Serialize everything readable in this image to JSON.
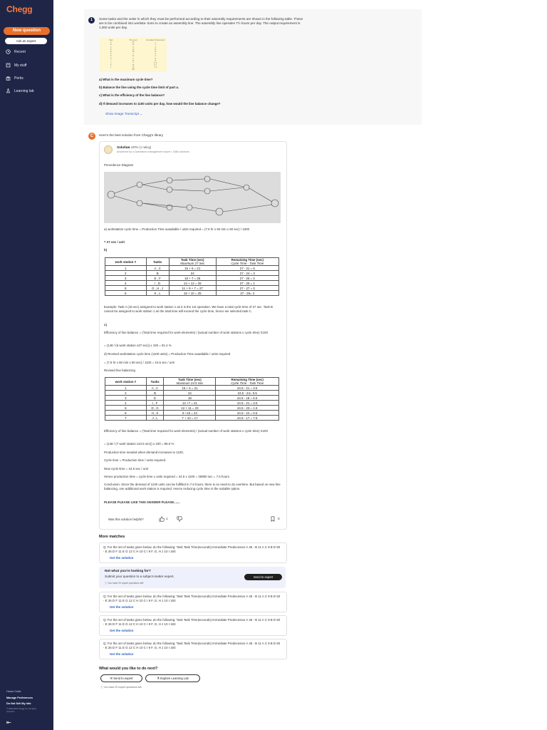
{
  "sidebar": {
    "logo": "Chegg",
    "new_question": "New question",
    "ask_expert": "Ask an expert",
    "nav": [
      {
        "label": "Recent",
        "icon": "clock-icon"
      },
      {
        "label": "My stuff",
        "icon": "box-icon"
      },
      {
        "label": "Perks",
        "icon": "gift-icon"
      },
      {
        "label": "Learning lab",
        "icon": "flask-icon"
      }
    ],
    "footer": [
      "Honor Code",
      "Manage Preferences",
      "Do Not Sell My Info"
    ],
    "copyright": "© 2003-2024 Chegg Inc. All rights reserved."
  },
  "question": {
    "number": "1",
    "text": "Some tasks and the order in which they must be performed according to their assembly requirements are shown in the following table. These are to be combined into worksta- tions to create an assembly line. The assembly line operates 7½ hours per day. The output requirement is 1,000 units per day.",
    "parts": [
      "a) What is the maximum cycle time?",
      "b) Balance the line using the cycle time limit of part a.",
      "c) What is the efficiency of the line balance?",
      "d) If demand increases to 1100 units per day, how would the line balance change?"
    ],
    "show_transcript": "Show Image Transcript"
  },
  "answer": {
    "intro": "Here's the best solution from Chegg's library",
    "solution_label": "Solution",
    "rating": "100% (1 rating)",
    "answered_by": "Answered by a Operations management expert  •  1684 solutions",
    "precedence": "Precedence Diagram",
    "a_line": "a) workstation cycle time = Production Time avaailable / units required = (7.5 hr x 60 min x 60 sec) / 1000",
    "a_result": "= 27 sec / unit",
    "b_label": "b)",
    "table1": {
      "headers": [
        "work station #",
        "Tasks",
        "Task Time (sec)",
        "Remaining Time (sec)"
      ],
      "subheaders": [
        "Maximum 27 Sec",
        "Cycle Time - Task Time"
      ],
      "rows": [
        [
          "1",
          "A , C",
          "15 + 6 = 21",
          "27 - 21 = 6"
        ],
        [
          "2",
          "B",
          "24",
          "27 - 24 = 3"
        ],
        [
          "3",
          "E , F",
          "18 + 7 = 25",
          "27 - 25 = 2"
        ],
        [
          "4",
          "I , D",
          "14 + 12 = 26",
          "27 - 26 = 1"
        ],
        [
          "5",
          "G , H , J",
          "11 + 9 + 7 = 27",
          "27 - 27 = 0"
        ],
        [
          "6",
          "K , L",
          "15 + 10 = 25",
          "27 - 25= 2"
        ]
      ]
    },
    "example": "Example: Task A (15 sec) assigned to work station 1 as it is the 1st operation. We have a total cycle time of 27 sec. Task B cannot be assigned to work station 1 as the total time will exceed the cycle time, hence we selected task C.",
    "c_label": "c)",
    "eff1": "Efficiency of line balance = (Total time required for work elements) / (actual number of work stations x cycle time) X100",
    "eff1_result": "= (148 / (6 work station x27 sec)) x 100 = 91.4 %",
    "d_line": "d) Revised workstation cycle time (1100 units) = Production Time avaailable / units required",
    "d_result": "= (7.5 hr x 60 min x 60 sec) / 1100 = 24.5 sec / unit",
    "revised": "Revised line balancing",
    "table2": {
      "headers": [
        "work station #",
        "Tasks",
        "Task Time (sec)",
        "Remaining Time (sec)"
      ],
      "subheaders": [
        "Maximum 24.5 Sec",
        "Cycle Time - Task Time"
      ],
      "rows": [
        [
          "1",
          "A , C",
          "15 + 6 = 21",
          "24.5 - 21 = 3.5"
        ],
        [
          "2",
          "B",
          "24",
          "24.5 - 24= 0.5"
        ],
        [
          "3",
          "E",
          "18",
          "24.5 - 18 = 6.5"
        ],
        [
          "4",
          "I , F",
          "14 +7 = 21",
          "24.5 - 21 = 3.5"
        ],
        [
          "5",
          "D , G",
          "12 + 11 = 23",
          "24.5 - 23 = 1.5"
        ],
        [
          "6",
          "H , K",
          "9 +15 = 24",
          "24.5 - 24 = 0.5"
        ],
        [
          "7",
          "J , L",
          "7 + 10 = 17",
          "24.5 - 17 = 7.5"
        ]
      ]
    },
    "eff2": "Efficiency of line balance = (Total time required for work elements) / (actual number of work stations x cycle time) X100",
    "eff2_result": "= (148 / (7 work station x24.5 sec)) x 100 = 86.0 %",
    "prod_time": "Production time needed when demand increases to 1100,",
    "cycle_eq": "Cycle time = Production time / units required",
    "new_cycle": "New cycle time = 24.5 sec / unit",
    "hence": "Hence production time = cycle time x units required = 24.5 x 1100 = 26950 sec = 7.5 hours",
    "conclusion": "Conclusion: Since the demand of 1100 units can be fulfilled in 7.5 hours, there is no need to do overtime. But based on new line balancing, one additional work station is required. Hence reducing cycle time is the suitable option.",
    "please": "PLEASE PLEASE LIKE THIS ANSWER PLEASE.......",
    "helpful": "Was this solution helpful?",
    "likes": "1",
    "bookmarks": "0"
  },
  "more_matches": {
    "title": "More matches",
    "item_text": "Q: For the set of tasks given below, do the following: Task Task Time(seconds) Immediate Predecessor A 45 - B 11 A C 9 B D 50 - E 26 D F 11 E G 12 C H 10 C I 9 F, G, H J 10 I 193",
    "get_solution": "Get the solution",
    "not_found_title": "Not what you're looking for?",
    "not_found_sub": "Submit your question to a subject-matter expert.",
    "questions_left": "You have 20 expert questions left.",
    "send_expert": "Send to expert"
  },
  "next": {
    "title": "What would you like to do next?",
    "send": "Send to expert",
    "explore": "Explore Learning Lab",
    "left": "You have 20 expert questions left."
  },
  "colors": {
    "sidebar": "#1f2547",
    "accent": "#e8702a",
    "link": "#2c5fc0"
  }
}
